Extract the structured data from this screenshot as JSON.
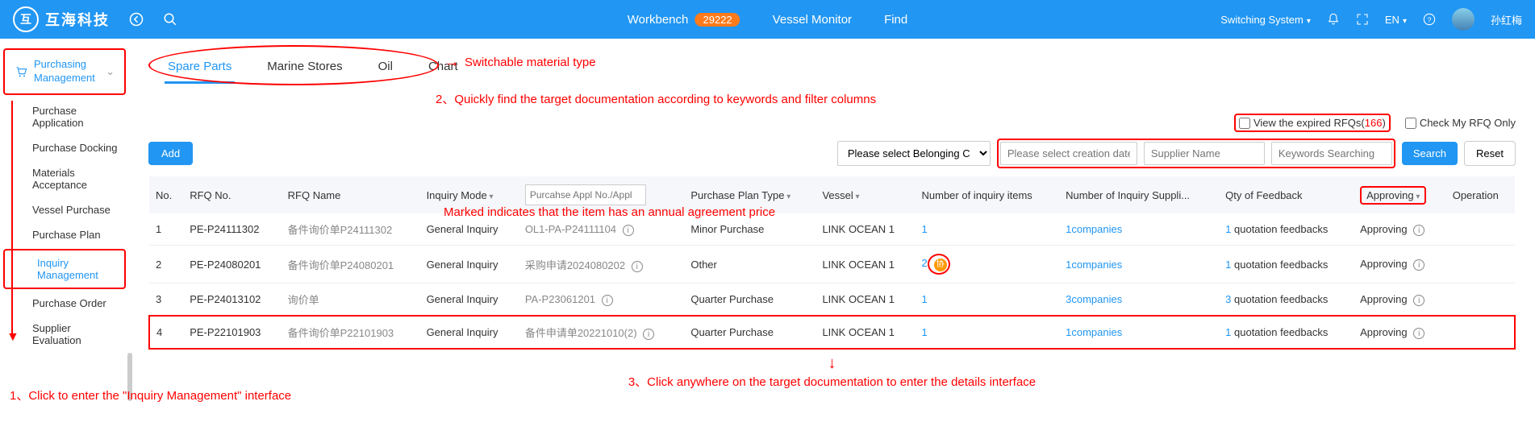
{
  "header": {
    "logo_text": "互海科技",
    "workbench": "Workbench",
    "workbench_badge": "29222",
    "vessel_monitor": "Vessel Monitor",
    "find": "Find",
    "switch_sys": "Switching System",
    "lang": "EN",
    "user": "孙红梅"
  },
  "sidebar": {
    "group": "Purchasing Management",
    "items": [
      "Purchase Application",
      "Purchase Docking",
      "Materials Acceptance",
      "Vessel Purchase",
      "Purchase Plan",
      "Inquiry Management",
      "Purchase Order",
      "Supplier Evaluation"
    ]
  },
  "tabs": [
    "Spare Parts",
    "Marine Stores",
    "Oil",
    "Chart"
  ],
  "annotations": {
    "tabs_note": "Switchable material type",
    "filters_note": "2、Quickly find the target documentation according to keywords and filter columns",
    "sidebar_note": "1、Click to enter the \"Inquiry Management\" interface",
    "row_note": "3、Click anywhere on the target documentation to enter the details interface",
    "marked_note": "Marked indicates that the item has an annual agreement price"
  },
  "top_right": {
    "expired_label_pre": "View the expired RFQs",
    "expired_count": "166",
    "my_only": "Check My RFQ Only"
  },
  "filters": {
    "add": "Add",
    "belonging_placeholder": "Please select Belonging C",
    "date_placeholder": "Please select creation date.",
    "supplier_placeholder": "Supplier Name",
    "keywords_placeholder": "Keywords Searching",
    "search": "Search",
    "reset": "Reset"
  },
  "columns": {
    "no": "No.",
    "rfq_no": "RFQ No.",
    "rfq_name": "RFQ Name",
    "inquiry_mode": "Inquiry Mode",
    "appl_placeholder": "Purcahse Appl No./Appl",
    "plan_type": "Purchase Plan Type",
    "vessel": "Vessel",
    "num_items": "Number of inquiry items",
    "num_suppliers": "Number of Inquiry Suppli...",
    "qty_feedback": "Qty of Feedback",
    "approving": "Approving",
    "operation": "Operation"
  },
  "feedback_suffix": " quotation feedbacks",
  "rows": [
    {
      "no": "1",
      "rfq_no": "PE-P24111302",
      "rfq_name": "备件询价单P24111302",
      "mode": "General Inquiry",
      "appl": "OL1-PA-P24111104",
      "plan": "Minor Purchase",
      "vessel": "LINK OCEAN 1",
      "items": "1",
      "suppliers": "1companies",
      "fb": "1",
      "status": "Approving",
      "marked": false
    },
    {
      "no": "2",
      "rfq_no": "PE-P24080201",
      "rfq_name": "备件询价单P24080201",
      "mode": "General Inquiry",
      "appl": "采购申请2024080202",
      "plan": "Other",
      "vessel": "LINK OCEAN 1",
      "items": "2",
      "suppliers": "1companies",
      "fb": "1",
      "status": "Approving",
      "marked": true
    },
    {
      "no": "3",
      "rfq_no": "PE-P24013102",
      "rfq_name": "询价单",
      "mode": "General Inquiry",
      "appl": "PA-P23061201",
      "plan": "Quarter Purchase",
      "vessel": "LINK OCEAN 1",
      "items": "1",
      "suppliers": "3companies",
      "fb": "3",
      "status": "Approving",
      "marked": false
    },
    {
      "no": "4",
      "rfq_no": "PE-P22101903",
      "rfq_name": "备件询价单P22101903",
      "mode": "General Inquiry",
      "appl": "备件申请单20221010(2)",
      "plan": "Quarter Purchase",
      "vessel": "LINK OCEAN 1",
      "items": "1",
      "suppliers": "1companies",
      "fb": "1",
      "status": "Approving",
      "marked": false
    }
  ]
}
